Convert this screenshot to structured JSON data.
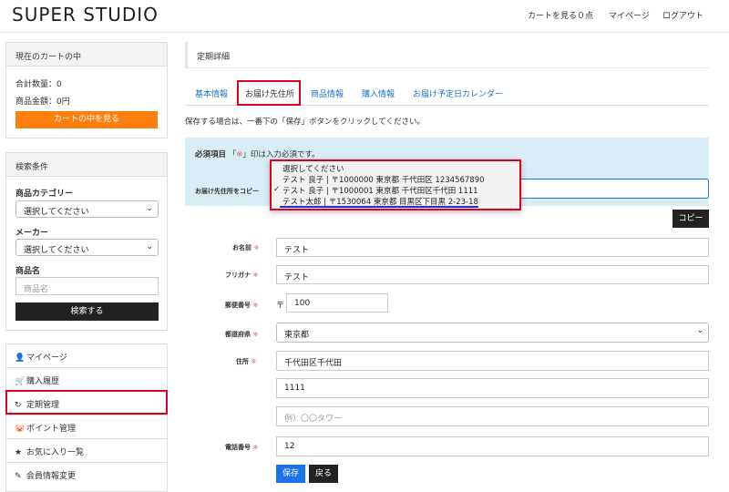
{
  "header": {
    "logo": "SUPER STUDIO",
    "cart_link": "カートを見る０点",
    "mypage_link": "マイページ",
    "logout_link": "ログアウト"
  },
  "cart": {
    "title": "現在のカートの中",
    "total_qty": "合計数量：0",
    "total_price": "商品金額：0円",
    "view_cart_button": "カートの中を見る"
  },
  "search": {
    "title": "検索条件",
    "category_label": "商品カテゴリー",
    "category_value": "選択してください",
    "maker_label": "メーカー",
    "maker_value": "選択してください",
    "name_label": "商品名",
    "name_placeholder": "商品名",
    "search_button": "検索する"
  },
  "menu": [
    {
      "icon": "user-icon",
      "label": "マイページ"
    },
    {
      "icon": "cart-icon",
      "label": "購入履歴"
    },
    {
      "icon": "refresh-icon",
      "label": "定期管理"
    },
    {
      "icon": "piggy-bank-icon",
      "label": "ポイント管理"
    },
    {
      "icon": "star-icon",
      "label": "お気に入り一覧"
    },
    {
      "icon": "pencil-icon",
      "label": "会員情報変更"
    }
  ],
  "main": {
    "page_title": "定期詳細",
    "tabs": [
      "基本情報",
      "お届け先住所",
      "商品情報",
      "購入情報",
      "お届け予定日カレンダー"
    ],
    "notice": "保存する場合は、一番下の「保存」ボタンをクリックしてください。",
    "required_note_prefix": "必須項目",
    "required_note_mid": "「",
    "required_mark": "※",
    "required_note_suffix": "」印は入力必須です。",
    "copy_label": "お届け先住所をコピー",
    "copy_options": [
      "選択してください",
      "テスト 良子 | 〒1000000 東京都 千代田区 1234567890",
      "テスト 良子 | 〒1000001 東京都 千代田区千代田 1111",
      "テスト太郎 | 〒1530064 東京都 目黒区下目黒 2-23-18"
    ],
    "checked_mark": "✓",
    "copy_button": "コピー",
    "req_mark": "※",
    "fields": {
      "name_label": "お名前",
      "name_value": "テスト",
      "kana_label": "フリガナ",
      "kana_value": "テスト",
      "zip_label": "郵便番号",
      "zip_prefix": "〒",
      "zip_value": "100",
      "pref_label": "都道府県",
      "pref_value": "東京都",
      "addr_label": "住所",
      "addr1_value": "千代田区千代田",
      "addr2_value": "1111",
      "addr3_placeholder": "例）〇〇タワー",
      "tel_label": "電話番号",
      "tel_value": "12"
    },
    "save_button": "保存",
    "back_button": "戻る"
  },
  "colors": {
    "accent_orange": "#ff7f0e",
    "link_blue": "#1a73c9",
    "highlight_red": "#e0001b",
    "info_blue": "#d9edf7",
    "save_blue": "#1a73e8"
  }
}
